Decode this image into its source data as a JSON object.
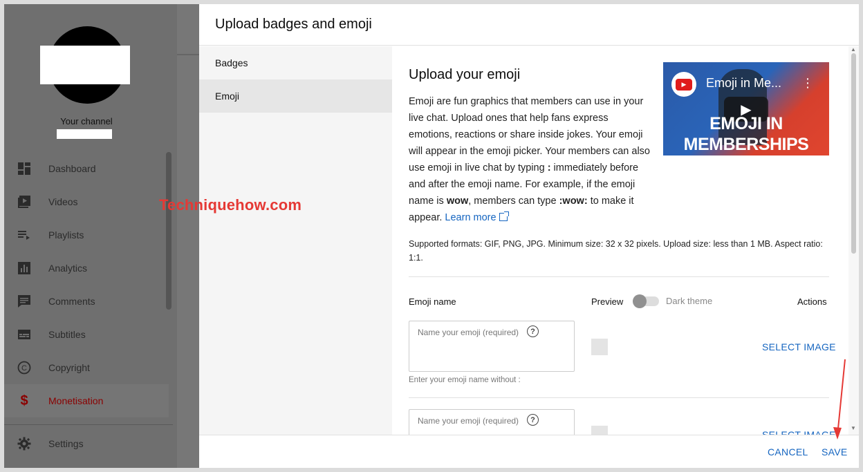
{
  "sidebar": {
    "channel_label": "Your channel",
    "items": [
      {
        "label": "Dashboard",
        "icon": "dashboard-icon"
      },
      {
        "label": "Videos",
        "icon": "video-library-icon"
      },
      {
        "label": "Playlists",
        "icon": "playlist-icon"
      },
      {
        "label": "Analytics",
        "icon": "analytics-icon"
      },
      {
        "label": "Comments",
        "icon": "comment-icon"
      },
      {
        "label": "Subtitles",
        "icon": "subtitles-icon"
      },
      {
        "label": "Copyright",
        "icon": "copyright-icon"
      },
      {
        "label": "Monetisation",
        "icon": "dollar-icon",
        "active": true
      }
    ],
    "settings": {
      "label": "Settings",
      "icon": "gear-icon"
    }
  },
  "watermark": "Techniquehow.com",
  "dialog": {
    "title": "Upload badges and emoji",
    "tabs": [
      {
        "label": "Badges"
      },
      {
        "label": "Emoji",
        "selected": true
      }
    ],
    "section_title": "Upload your emoji",
    "description": {
      "part1": "Emoji are fun graphics that members can use in your live chat. Upload ones that help fans express emotions, reactions or share inside jokes. Your emoji will appear in the emoji picker. Your members can also use emoji in live chat by typing ",
      "colon": ":",
      "part2": " immediately before and after the emoji name. For example, if the emoji name is ",
      "wow": "wow",
      "part3": ", members can type ",
      "wow_code": ":wow:",
      "part4": " to make it appear. ",
      "learn_more": "Learn more"
    },
    "video": {
      "title": "Emoji in Me...",
      "caption_line1": "EMOJI IN",
      "caption_line2": "MEMBERSHIPS"
    },
    "formats": "Supported formats: GIF, PNG, JPG. Minimum size: 32 x 32 pixels. Upload size: less than 1 MB. Aspect ratio: 1:1.",
    "table": {
      "col_name": "Emoji name",
      "col_preview": "Preview",
      "dark_theme_label": "Dark theme",
      "col_actions": "Actions",
      "rows": [
        {
          "placeholder": "Name your emoji (required)",
          "hint": "Enter your emoji name without :",
          "action": "SELECT IMAGE"
        },
        {
          "placeholder": "Name your emoji (required)",
          "action": "SELECT IMAGE"
        }
      ]
    },
    "footer": {
      "cancel": "CANCEL",
      "save": "SAVE"
    }
  },
  "colors": {
    "link_blue": "#1565c0",
    "watermark_red": "#e53935",
    "active_nav_red": "#8b0000"
  }
}
